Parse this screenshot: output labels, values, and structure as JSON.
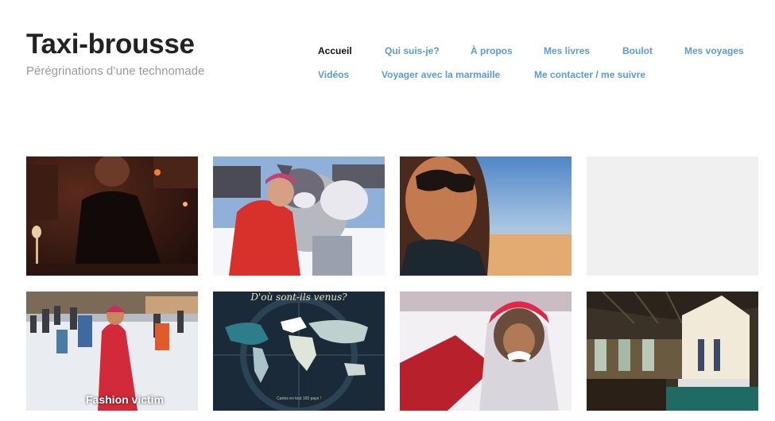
{
  "header": {
    "title": "Taxi-brousse",
    "tagline": "Pérégrinations d’une technomade"
  },
  "nav": {
    "items": [
      {
        "label": "Accueil",
        "current": true
      },
      {
        "label": "Qui suis-je?"
      },
      {
        "label": "À propos"
      },
      {
        "label": "Mes livres"
      },
      {
        "label": "Boulot"
      },
      {
        "label": "Mes voyages"
      },
      {
        "label": "Vidéos"
      },
      {
        "label": "Voyager avec la marmaille"
      },
      {
        "label": "Me contacter / me suivre"
      }
    ]
  },
  "gallery": {
    "tiles": [
      {
        "subject": "man-in-restaurant"
      },
      {
        "subject": "woman-with-mascot"
      },
      {
        "subject": "woman-sunglasses-beach"
      },
      {
        "subject": "placeholder"
      },
      {
        "subject": "woman-in-snow-crowd",
        "caption": "Fashion victim"
      },
      {
        "subject": "world-map",
        "map_title": "D'où sont-ils venus?",
        "map_footer": "Cartes en tout 165 pays !"
      },
      {
        "subject": "child-in-snow"
      },
      {
        "subject": "church-interior"
      }
    ]
  },
  "colors": {
    "link": "#5b9bd5",
    "current_link": "#111111",
    "title": "#222222",
    "tagline": "#9a9a9a",
    "placeholder": "#f0f0f0"
  }
}
